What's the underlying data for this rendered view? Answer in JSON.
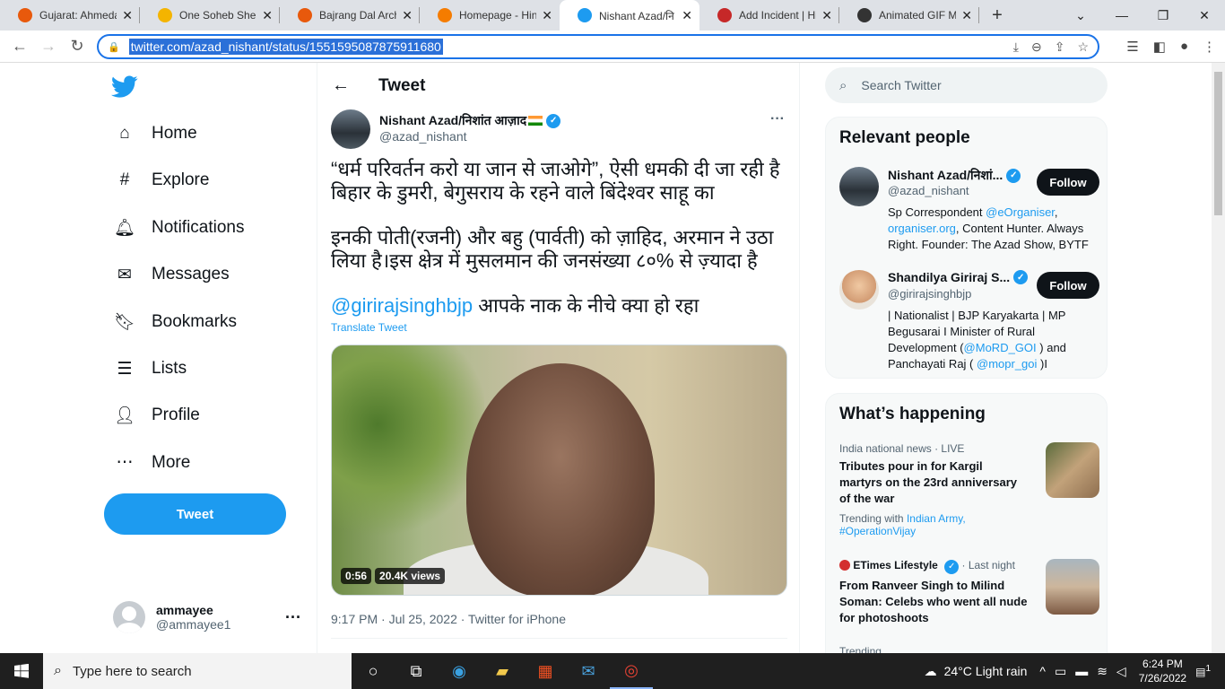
{
  "browser": {
    "tabs": [
      {
        "title": "Gujarat: Ahmedal",
        "color": "#e8590c"
      },
      {
        "title": "One Soheb Sheik",
        "color": "#f4b400"
      },
      {
        "title": "Bajrang Dal Arch",
        "color": "#e8590c"
      },
      {
        "title": "Homepage - Hin",
        "color": "#f57c00"
      },
      {
        "title": "Nishant Azad/नि",
        "color": "#1d9bf0"
      },
      {
        "title": "Add Incident | Hi",
        "color": "#c62828"
      },
      {
        "title": "Animated GIF Ma",
        "color": "#333333"
      }
    ],
    "url": "twitter.com/azad_nishant/status/1551595087875911680"
  },
  "nav": {
    "items": [
      {
        "label": "Home",
        "icon": "home-icon"
      },
      {
        "label": "Explore",
        "icon": "hashtag-icon"
      },
      {
        "label": "Notifications",
        "icon": "bell-icon"
      },
      {
        "label": "Messages",
        "icon": "mail-icon"
      },
      {
        "label": "Bookmarks",
        "icon": "bookmark-icon"
      },
      {
        "label": "Lists",
        "icon": "list-icon"
      },
      {
        "label": "Profile",
        "icon": "person-icon"
      },
      {
        "label": "More",
        "icon": "more-circle-icon"
      }
    ],
    "tweet_button": "Tweet",
    "user": {
      "name": "ammayee",
      "handle": "@ammayee1"
    }
  },
  "tweet": {
    "header": "Tweet",
    "author": "Nishant Azad/निशांत आज़ाद",
    "handle": "@azad_nishant",
    "line1": "“धर्म परिवर्तन करो या जान से जाओगे”, ऐसी धमकी दी जा रही है बिहार के डुमरी, बेगुसराय के रहने वाले बिंदेश्वर साहू का",
    "line2": "इनकी पोती(रजनी) और बहु (पार्वती) को ज़ाहिद, अरमान ने उठा लिया है।इस क्षेत्र में मुसलमान की जनसंख्या ८०% से ज़्यादा है",
    "mention": "@girirajsinghbjp",
    "line3": " आपके नाक के नीचे क्या हो रहा",
    "translate": "Translate Tweet",
    "video_time": "0:56",
    "video_views": "20.4K views",
    "meta": "9:17 PM · Jul 25, 2022 · Twitter for iPhone"
  },
  "sidebar": {
    "search_placeholder": "Search Twitter",
    "relevant_title": "Relevant people",
    "people": [
      {
        "name": "Nishant Azad/निशां...",
        "handle": "@azad_nishant",
        "follow": "Follow",
        "bio_a": "Sp Correspondent ",
        "bio_link1": "@eOrganiser",
        "bio_b": ", ",
        "bio_link2": "organiser.org",
        "bio_c": ", Content Hunter. Always Right. Founder: The Azad Show, BYTF"
      },
      {
        "name": "Shandilya Giriraj S...",
        "handle": "@girirajsinghbjp",
        "follow": "Follow",
        "bio_a": "| Nationalist | BJP Karyakarta | MP Begusarai  I Minister of Rural Development (",
        "bio_link1": "@MoRD_GOI",
        "bio_b": " ) and Panchayati Raj ( ",
        "bio_link2": "@mopr_goi",
        "bio_c": " )I"
      }
    ],
    "happening_title": "What’s happening",
    "trends": [
      {
        "cat": "India national news · LIVE",
        "title": "Tributes pour in for Kargil martyrs on the 23rd anniversary of the war",
        "sub": "Trending with ",
        "sub_link": "Indian Army, #OperationVijay"
      },
      {
        "cat_source": "ETimes Lifestyle",
        "cat_time": "· Last night",
        "title": "From Ranveer Singh to Milind Soman: Celebs who went all nude for photoshoots"
      }
    ],
    "more_label": "Trending"
  },
  "taskbar": {
    "search": "Type here to search",
    "weather": "24°C  Light rain",
    "time": "6:24 PM",
    "date": "7/26/2022",
    "notif_count": "1"
  }
}
